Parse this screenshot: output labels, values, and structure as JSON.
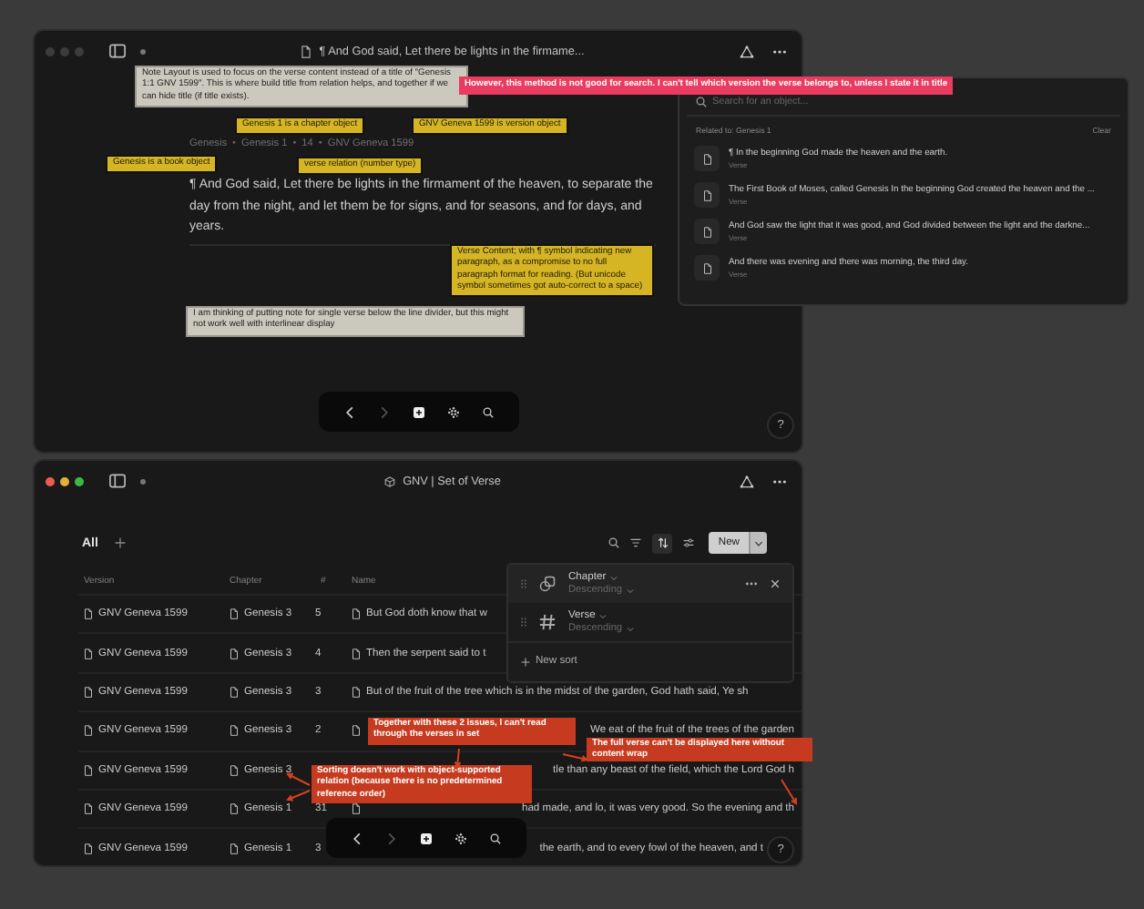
{
  "note_window": {
    "focused": false,
    "title": "¶ And God said, Let there be lights in the firmame...",
    "breadcrumb": [
      "Genesis",
      "Genesis 1",
      "14",
      "GNV Geneva 1599"
    ],
    "breadcrumb_separator": "•",
    "verse": "¶ And God said, Let there be lights in the firmament of the heaven, to separate the day from the night, and let them be for signs, and for seasons, and for days, and years.",
    "help": "?"
  },
  "search_popup": {
    "placeholder": "Search for an object...",
    "related_label": "Related to: Genesis 1",
    "clear": "Clear",
    "results": [
      {
        "title": "¶ In the beginning God made the heaven and the earth.",
        "type": "Verse"
      },
      {
        "title": "The First Book of Moses, called Genesis In the beginning God created the heaven and the ...",
        "type": "Verse"
      },
      {
        "title": "And God saw the light that it was good, and God divided between the light and the darkne...",
        "type": "Verse"
      },
      {
        "title": "And there was evening and there was morning, the third day.",
        "type": "Verse"
      }
    ]
  },
  "set_window": {
    "focused": true,
    "title": "GNV | Set of Verse",
    "view": "All",
    "new_button": "New",
    "sort_open": true,
    "columns": [
      "Version",
      "Chapter",
      "#",
      "Name"
    ],
    "rows": [
      {
        "version": "GNV Geneva 1599",
        "chapter": "Genesis 3",
        "verse": "5",
        "name": "But God doth know that w",
        "starts_hidden": false,
        "name_icon": true
      },
      {
        "version": "GNV Geneva 1599",
        "chapter": "Genesis 3",
        "verse": "4",
        "name": "Then the serpent said to t",
        "starts_hidden": false,
        "name_icon": true
      },
      {
        "version": "GNV Geneva 1599",
        "chapter": "Genesis 3",
        "verse": "3",
        "name": "But of the fruit of the tree which is in the midst of the garden, God hath said, Ye sh",
        "starts_hidden": false,
        "name_icon": true
      },
      {
        "version": "GNV Geneva 1599",
        "chapter": "Genesis 3",
        "verse": "2",
        "name": "We eat of the fruit of the trees of the garden",
        "starts_hidden": true,
        "name_icon": true
      },
      {
        "version": "GNV Geneva 1599",
        "chapter": "Genesis 3",
        "name": "tle than any beast of the field, which the Lord God h",
        "starts_hidden": true,
        "name_icon": false
      },
      {
        "version": "GNV Geneva 1599",
        "chapter": "Genesis 1",
        "verse": "31",
        "name": "had made, and lo, it was very good. So the evening and th",
        "starts_hidden": true,
        "name_icon": true
      },
      {
        "version": "GNV Geneva 1599",
        "chapter": "Genesis 1",
        "verse": "3",
        "name": "the earth, and to every fowl of the heaven, and t",
        "starts_hidden": true,
        "name_icon": false
      }
    ],
    "help": "?"
  },
  "sort_popup": {
    "sorts": [
      {
        "property": "Chapter",
        "order": "Descending",
        "kind": "object",
        "hovered": true
      },
      {
        "property": "Verse",
        "order": "Descending",
        "kind": "number",
        "hovered": false
      }
    ],
    "new_sort": "New sort"
  },
  "annotations": [
    {
      "kind": "note",
      "text": "Note Layout is used to focus on the verse content instead of a title of \"Genesis 1:1 GNV 1599\". This is where build title from relation helps, and together if we can hide title (if title exists)."
    },
    {
      "kind": "alert",
      "text": "However, this method is not good for search.  I can't tell which version the verse belongs to, unless I state it in title"
    },
    {
      "kind": "label",
      "text": "Genesis 1 is a chapter object"
    },
    {
      "kind": "label",
      "text": "GNV Geneva 1599 is version object"
    },
    {
      "kind": "label",
      "text": "Genesis is a book object"
    },
    {
      "kind": "label",
      "text": "verse relation (number type)"
    },
    {
      "kind": "label",
      "text": "Verse Content; with ¶ symbol indicating new paragraph, as a compromise to no full paragraph format for reading. (But unicode symbol sometimes got auto-correct to a space)"
    },
    {
      "kind": "note",
      "text": "I am thinking of putting note for single verse below the line divider, but this might not work well with interlinear display"
    },
    {
      "kind": "issue",
      "text": "Together with these 2 issues, I can't read through the verses in set"
    },
    {
      "kind": "issue",
      "text": "The full verse can't be displayed here without content wrap"
    },
    {
      "kind": "issue",
      "text": "Sorting doesn't work with object-supported relation (because there is no predetermined reference order)"
    }
  ]
}
